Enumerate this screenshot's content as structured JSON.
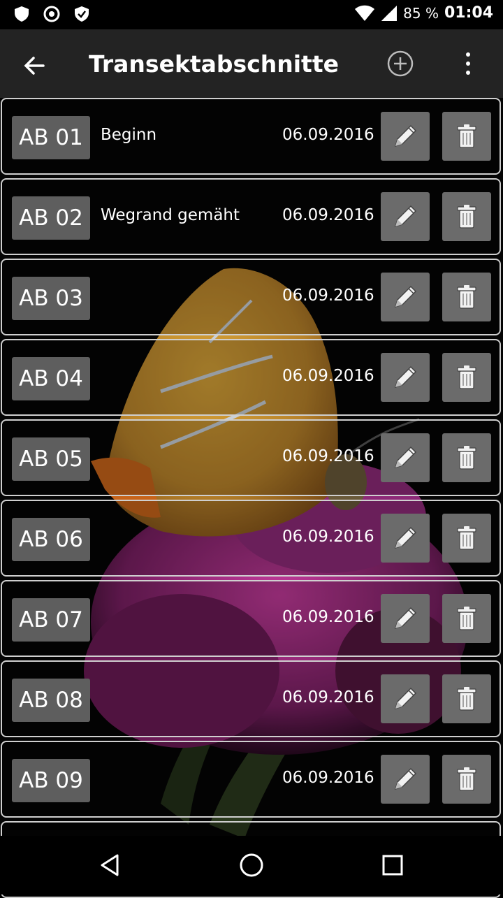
{
  "status_bar": {
    "battery_percent": "85 %",
    "time": "01:04",
    "icons": [
      "shield-icon",
      "target-icon",
      "shield-check-icon",
      "wifi-icon",
      "signal-icon",
      "battery-icon"
    ]
  },
  "app_bar": {
    "title": "Transektabschnitte",
    "icons": [
      "back-arrow-icon",
      "add-circle-icon",
      "overflow-menu-icon"
    ]
  },
  "rows": [
    {
      "code": "AB 01",
      "description": "Beginn",
      "date": "06.09.2016"
    },
    {
      "code": "AB 02",
      "description": "Wegrand gemäht",
      "date": "06.09.2016"
    },
    {
      "code": "AB 03",
      "description": "",
      "date": "06.09.2016"
    },
    {
      "code": "AB 04",
      "description": "",
      "date": "06.09.2016"
    },
    {
      "code": "AB 05",
      "description": "",
      "date": "06.09.2016"
    },
    {
      "code": "AB 06",
      "description": "",
      "date": "06.09.2016"
    },
    {
      "code": "AB 07",
      "description": "",
      "date": "06.09.2016"
    },
    {
      "code": "AB 08",
      "description": "",
      "date": "06.09.2016"
    },
    {
      "code": "AB 09",
      "description": "",
      "date": "06.09.2016"
    }
  ],
  "row_icons": {
    "edit": "pencil-icon",
    "delete": "trash-icon"
  },
  "nav_bar": {
    "icons": [
      "back-triangle-icon",
      "home-circle-icon",
      "recents-square-icon"
    ]
  },
  "colors": {
    "app_bar": "#232323",
    "button_bg": "#6b6b6b",
    "code_bg": "#5e5e5e",
    "row_border": "#cfcfcf"
  }
}
